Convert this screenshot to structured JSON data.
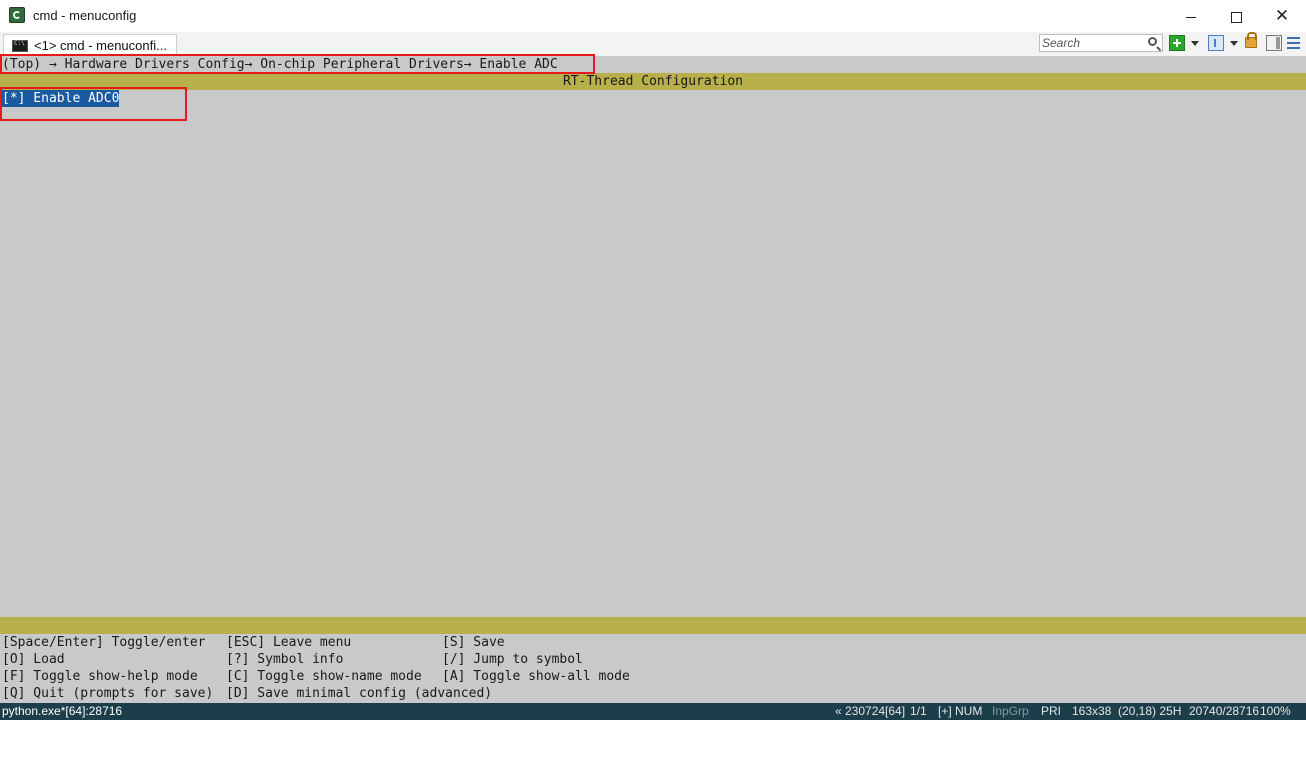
{
  "window": {
    "title": "cmd - menuconfig",
    "controls": {
      "minimize": "minimize",
      "maximize": "maximize",
      "close": "close"
    }
  },
  "tabs": [
    {
      "label": "<1> cmd - menuconfi..."
    }
  ],
  "toolbar": {
    "search_placeholder": "Search"
  },
  "console": {
    "breadcrumb": "(Top) → Hardware Drivers Config→ On-chip Peripheral Drivers→ Enable ADC",
    "config_title": "RT-Thread Configuration",
    "entries": [
      {
        "label": "[*] Enable ADC0",
        "selected": true
      }
    ],
    "help": [
      [
        "[Space/Enter] Toggle/enter",
        "[ESC] Leave menu",
        "[S] Save"
      ],
      [
        "[O] Load",
        "[?] Symbol info",
        "[/] Jump to symbol"
      ],
      [
        "[F] Toggle show-help mode",
        "[C] Toggle show-name mode",
        "[A] Toggle show-all mode"
      ],
      [
        "[Q] Quit (prompts for save)",
        "[D] Save minimal config (advanced)",
        ""
      ]
    ],
    "colors": {
      "background": "#c9c9c9",
      "bar": "#b8b04a",
      "selection": "#1a5aa0",
      "highlight_box": "#e8191a"
    }
  },
  "status": {
    "process": "python.exe*[64]:28716",
    "pid": "« 230724[64]",
    "page": "1/1",
    "mode": "[+] NUM",
    "inpgrp": "InpGrp",
    "priority": "PRI",
    "size": "163x38",
    "cursor": "(20,18) 25H",
    "buffer": "20740/28716",
    "zoom": "100%"
  }
}
